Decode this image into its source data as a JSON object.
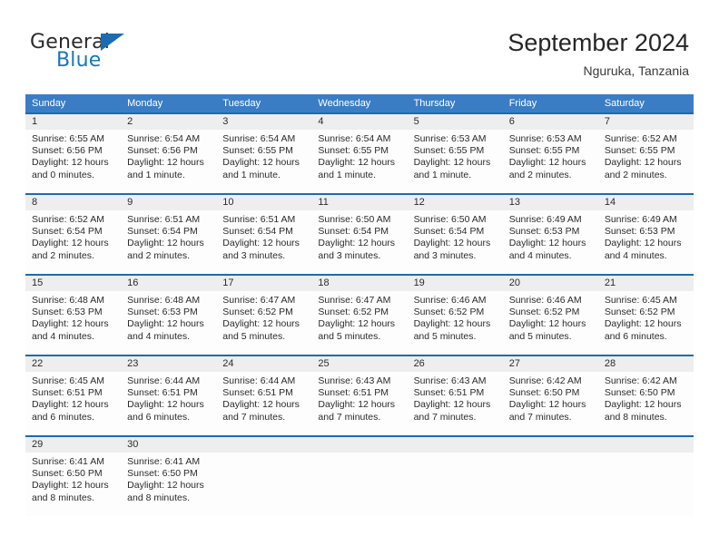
{
  "brand": {
    "word_one": "General",
    "word_two": "Blue",
    "flag_icon": "blue-triangle-flag-icon",
    "accent_color": "#1b75bb"
  },
  "header": {
    "title": "September 2024",
    "subtitle": "Nguruka, Tanzania"
  },
  "colors": {
    "header_row_blue": "#3b7dc4",
    "week_divider_blue": "#1b6cb0",
    "daynum_band_gray": "#eeeeee",
    "cell_background": "#fdfdfd",
    "text": "#2b2b2b"
  },
  "calendar": {
    "weekday_headers": [
      "Sunday",
      "Monday",
      "Tuesday",
      "Wednesday",
      "Thursday",
      "Friday",
      "Saturday"
    ],
    "weeks": [
      [
        {
          "day": "1",
          "sunrise": "Sunrise: 6:55 AM",
          "sunset": "Sunset: 6:56 PM",
          "daylight_1": "Daylight: 12 hours",
          "daylight_2": "and 0 minutes."
        },
        {
          "day": "2",
          "sunrise": "Sunrise: 6:54 AM",
          "sunset": "Sunset: 6:56 PM",
          "daylight_1": "Daylight: 12 hours",
          "daylight_2": "and 1 minute."
        },
        {
          "day": "3",
          "sunrise": "Sunrise: 6:54 AM",
          "sunset": "Sunset: 6:55 PM",
          "daylight_1": "Daylight: 12 hours",
          "daylight_2": "and 1 minute."
        },
        {
          "day": "4",
          "sunrise": "Sunrise: 6:54 AM",
          "sunset": "Sunset: 6:55 PM",
          "daylight_1": "Daylight: 12 hours",
          "daylight_2": "and 1 minute."
        },
        {
          "day": "5",
          "sunrise": "Sunrise: 6:53 AM",
          "sunset": "Sunset: 6:55 PM",
          "daylight_1": "Daylight: 12 hours",
          "daylight_2": "and 1 minute."
        },
        {
          "day": "6",
          "sunrise": "Sunrise: 6:53 AM",
          "sunset": "Sunset: 6:55 PM",
          "daylight_1": "Daylight: 12 hours",
          "daylight_2": "and 2 minutes."
        },
        {
          "day": "7",
          "sunrise": "Sunrise: 6:52 AM",
          "sunset": "Sunset: 6:55 PM",
          "daylight_1": "Daylight: 12 hours",
          "daylight_2": "and 2 minutes."
        }
      ],
      [
        {
          "day": "8",
          "sunrise": "Sunrise: 6:52 AM",
          "sunset": "Sunset: 6:54 PM",
          "daylight_1": "Daylight: 12 hours",
          "daylight_2": "and 2 minutes."
        },
        {
          "day": "9",
          "sunrise": "Sunrise: 6:51 AM",
          "sunset": "Sunset: 6:54 PM",
          "daylight_1": "Daylight: 12 hours",
          "daylight_2": "and 2 minutes."
        },
        {
          "day": "10",
          "sunrise": "Sunrise: 6:51 AM",
          "sunset": "Sunset: 6:54 PM",
          "daylight_1": "Daylight: 12 hours",
          "daylight_2": "and 3 minutes."
        },
        {
          "day": "11",
          "sunrise": "Sunrise: 6:50 AM",
          "sunset": "Sunset: 6:54 PM",
          "daylight_1": "Daylight: 12 hours",
          "daylight_2": "and 3 minutes."
        },
        {
          "day": "12",
          "sunrise": "Sunrise: 6:50 AM",
          "sunset": "Sunset: 6:54 PM",
          "daylight_1": "Daylight: 12 hours",
          "daylight_2": "and 3 minutes."
        },
        {
          "day": "13",
          "sunrise": "Sunrise: 6:49 AM",
          "sunset": "Sunset: 6:53 PM",
          "daylight_1": "Daylight: 12 hours",
          "daylight_2": "and 4 minutes."
        },
        {
          "day": "14",
          "sunrise": "Sunrise: 6:49 AM",
          "sunset": "Sunset: 6:53 PM",
          "daylight_1": "Daylight: 12 hours",
          "daylight_2": "and 4 minutes."
        }
      ],
      [
        {
          "day": "15",
          "sunrise": "Sunrise: 6:48 AM",
          "sunset": "Sunset: 6:53 PM",
          "daylight_1": "Daylight: 12 hours",
          "daylight_2": "and 4 minutes."
        },
        {
          "day": "16",
          "sunrise": "Sunrise: 6:48 AM",
          "sunset": "Sunset: 6:53 PM",
          "daylight_1": "Daylight: 12 hours",
          "daylight_2": "and 4 minutes."
        },
        {
          "day": "17",
          "sunrise": "Sunrise: 6:47 AM",
          "sunset": "Sunset: 6:52 PM",
          "daylight_1": "Daylight: 12 hours",
          "daylight_2": "and 5 minutes."
        },
        {
          "day": "18",
          "sunrise": "Sunrise: 6:47 AM",
          "sunset": "Sunset: 6:52 PM",
          "daylight_1": "Daylight: 12 hours",
          "daylight_2": "and 5 minutes."
        },
        {
          "day": "19",
          "sunrise": "Sunrise: 6:46 AM",
          "sunset": "Sunset: 6:52 PM",
          "daylight_1": "Daylight: 12 hours",
          "daylight_2": "and 5 minutes."
        },
        {
          "day": "20",
          "sunrise": "Sunrise: 6:46 AM",
          "sunset": "Sunset: 6:52 PM",
          "daylight_1": "Daylight: 12 hours",
          "daylight_2": "and 5 minutes."
        },
        {
          "day": "21",
          "sunrise": "Sunrise: 6:45 AM",
          "sunset": "Sunset: 6:52 PM",
          "daylight_1": "Daylight: 12 hours",
          "daylight_2": "and 6 minutes."
        }
      ],
      [
        {
          "day": "22",
          "sunrise": "Sunrise: 6:45 AM",
          "sunset": "Sunset: 6:51 PM",
          "daylight_1": "Daylight: 12 hours",
          "daylight_2": "and 6 minutes."
        },
        {
          "day": "23",
          "sunrise": "Sunrise: 6:44 AM",
          "sunset": "Sunset: 6:51 PM",
          "daylight_1": "Daylight: 12 hours",
          "daylight_2": "and 6 minutes."
        },
        {
          "day": "24",
          "sunrise": "Sunrise: 6:44 AM",
          "sunset": "Sunset: 6:51 PM",
          "daylight_1": "Daylight: 12 hours",
          "daylight_2": "and 7 minutes."
        },
        {
          "day": "25",
          "sunrise": "Sunrise: 6:43 AM",
          "sunset": "Sunset: 6:51 PM",
          "daylight_1": "Daylight: 12 hours",
          "daylight_2": "and 7 minutes."
        },
        {
          "day": "26",
          "sunrise": "Sunrise: 6:43 AM",
          "sunset": "Sunset: 6:51 PM",
          "daylight_1": "Daylight: 12 hours",
          "daylight_2": "and 7 minutes."
        },
        {
          "day": "27",
          "sunrise": "Sunrise: 6:42 AM",
          "sunset": "Sunset: 6:50 PM",
          "daylight_1": "Daylight: 12 hours",
          "daylight_2": "and 7 minutes."
        },
        {
          "day": "28",
          "sunrise": "Sunrise: 6:42 AM",
          "sunset": "Sunset: 6:50 PM",
          "daylight_1": "Daylight: 12 hours",
          "daylight_2": "and 8 minutes."
        }
      ],
      [
        {
          "day": "29",
          "sunrise": "Sunrise: 6:41 AM",
          "sunset": "Sunset: 6:50 PM",
          "daylight_1": "Daylight: 12 hours",
          "daylight_2": "and 8 minutes."
        },
        {
          "day": "30",
          "sunrise": "Sunrise: 6:41 AM",
          "sunset": "Sunset: 6:50 PM",
          "daylight_1": "Daylight: 12 hours",
          "daylight_2": "and 8 minutes."
        },
        {
          "day": "",
          "sunrise": "",
          "sunset": "",
          "daylight_1": "",
          "daylight_2": ""
        },
        {
          "day": "",
          "sunrise": "",
          "sunset": "",
          "daylight_1": "",
          "daylight_2": ""
        },
        {
          "day": "",
          "sunrise": "",
          "sunset": "",
          "daylight_1": "",
          "daylight_2": ""
        },
        {
          "day": "",
          "sunrise": "",
          "sunset": "",
          "daylight_1": "",
          "daylight_2": ""
        },
        {
          "day": "",
          "sunrise": "",
          "sunset": "",
          "daylight_1": "",
          "daylight_2": ""
        }
      ]
    ]
  }
}
